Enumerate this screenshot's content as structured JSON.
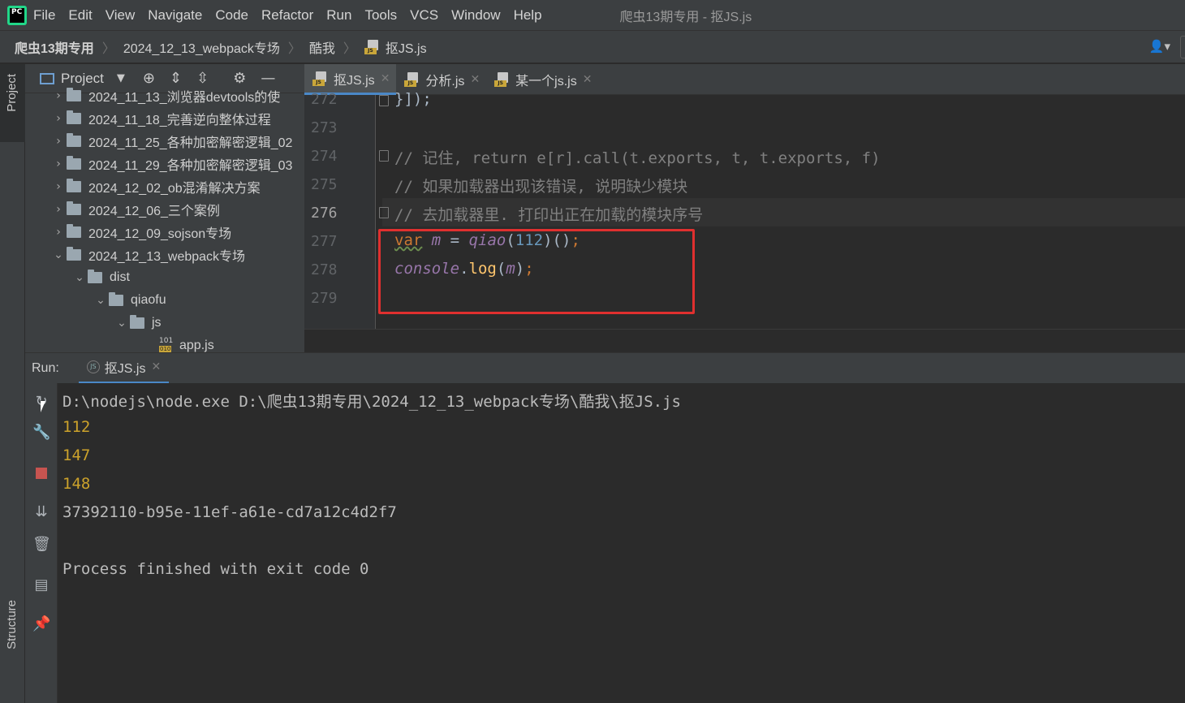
{
  "menubar": {
    "items": [
      "File",
      "Edit",
      "View",
      "Navigate",
      "Code",
      "Refactor",
      "Run",
      "Tools",
      "VCS",
      "Window",
      "Help"
    ],
    "window_title": "爬虫13期专用 - 抠JS.js",
    "logo_text": "PC"
  },
  "breadcrumb": {
    "project": "爬虫13期专用",
    "folder": "2024_12_13_webpack专场",
    "subfolder": "酷我",
    "file": "抠JS.js"
  },
  "left_stripe": {
    "project_label": "Project",
    "structure_label": "Structure"
  },
  "project_panel": {
    "title": "Project",
    "tree": [
      {
        "label": "2024_11_13_浏览器devtools的使",
        "arrow": "›"
      },
      {
        "label": "2024_11_18_完善逆向整体过程",
        "arrow": "›"
      },
      {
        "label": "2024_11_25_各种加密解密逻辑_02",
        "arrow": "›"
      },
      {
        "label": "2024_11_29_各种加密解密逻辑_03",
        "arrow": "›"
      },
      {
        "label": "2024_12_02_ob混淆解决方案",
        "arrow": "›"
      },
      {
        "label": "2024_12_06_三个案例",
        "arrow": "›"
      },
      {
        "label": "2024_12_09_sojson专场",
        "arrow": "›"
      },
      {
        "label": "2024_12_13_webpack专场",
        "arrow": "⌄"
      },
      {
        "label": "dist",
        "arrow": "⌄"
      },
      {
        "label": "qiaofu",
        "arrow": "⌄"
      },
      {
        "label": "js",
        "arrow": "⌄"
      },
      {
        "label": "app.js",
        "arrow": ""
      }
    ]
  },
  "editor": {
    "tabs": [
      {
        "label": "抠JS.js",
        "active": true
      },
      {
        "label": "分析.js",
        "active": false
      },
      {
        "label": "某一个js.js",
        "active": false
      }
    ],
    "line_numbers": [
      "272",
      "273",
      "274",
      "275",
      "276",
      "277",
      "278",
      "279"
    ],
    "current_line": "276",
    "code": {
      "l272": "}]);",
      "l274": "// 记住, return e[r].call(t.exports, t, t.exports, f)",
      "l275": "// 如果加载器出现该错误, 说明缺少模块",
      "l276": "// 去加载器里. 打印出正在加载的模块序号",
      "l277_kw": "var",
      "l277_var": "m",
      "l277_eq": " = ",
      "l277_fn": "qiao",
      "l277_open": "(",
      "l277_num": "112",
      "l277_close": ")()",
      "l277_semi": ";",
      "l278_obj": "console",
      "l278_dot": ".",
      "l278_method": "log",
      "l278_open": "(",
      "l278_arg": "m",
      "l278_close": ")",
      "l278_semi": ";"
    }
  },
  "run_panel": {
    "label": "Run:",
    "tab": "抠JS.js",
    "console": [
      {
        "text": "D:\\nodejs\\node.exe D:\\爬虫13期专用\\2024_12_13_webpack专场\\酷我\\抠JS.js",
        "style": "plain"
      },
      {
        "text": "112",
        "style": "yellow"
      },
      {
        "text": "147",
        "style": "yellow"
      },
      {
        "text": "148",
        "style": "yellow"
      },
      {
        "text": "37392110-b95e-11ef-a61e-cd7a12c4d2f7",
        "style": "plain"
      },
      {
        "text": "",
        "style": "plain"
      },
      {
        "text": "Process finished with exit code 0",
        "style": "plain"
      }
    ]
  },
  "colors": {
    "highlight_box": "#e0302f",
    "accent": "#4a88c7",
    "console_number": "#cca22b"
  },
  "icons": [
    "pycharm-logo-icon",
    "js-file-icon",
    "folder-icon",
    "rerun-icon",
    "wrench-icon",
    "stop-icon",
    "scroll-down-icon",
    "trash-icon",
    "layout-icon",
    "pin-icon",
    "gear-icon",
    "locate-icon",
    "expand-all-icon",
    "collapse-all-icon",
    "minimize-icon",
    "user-icon"
  ]
}
